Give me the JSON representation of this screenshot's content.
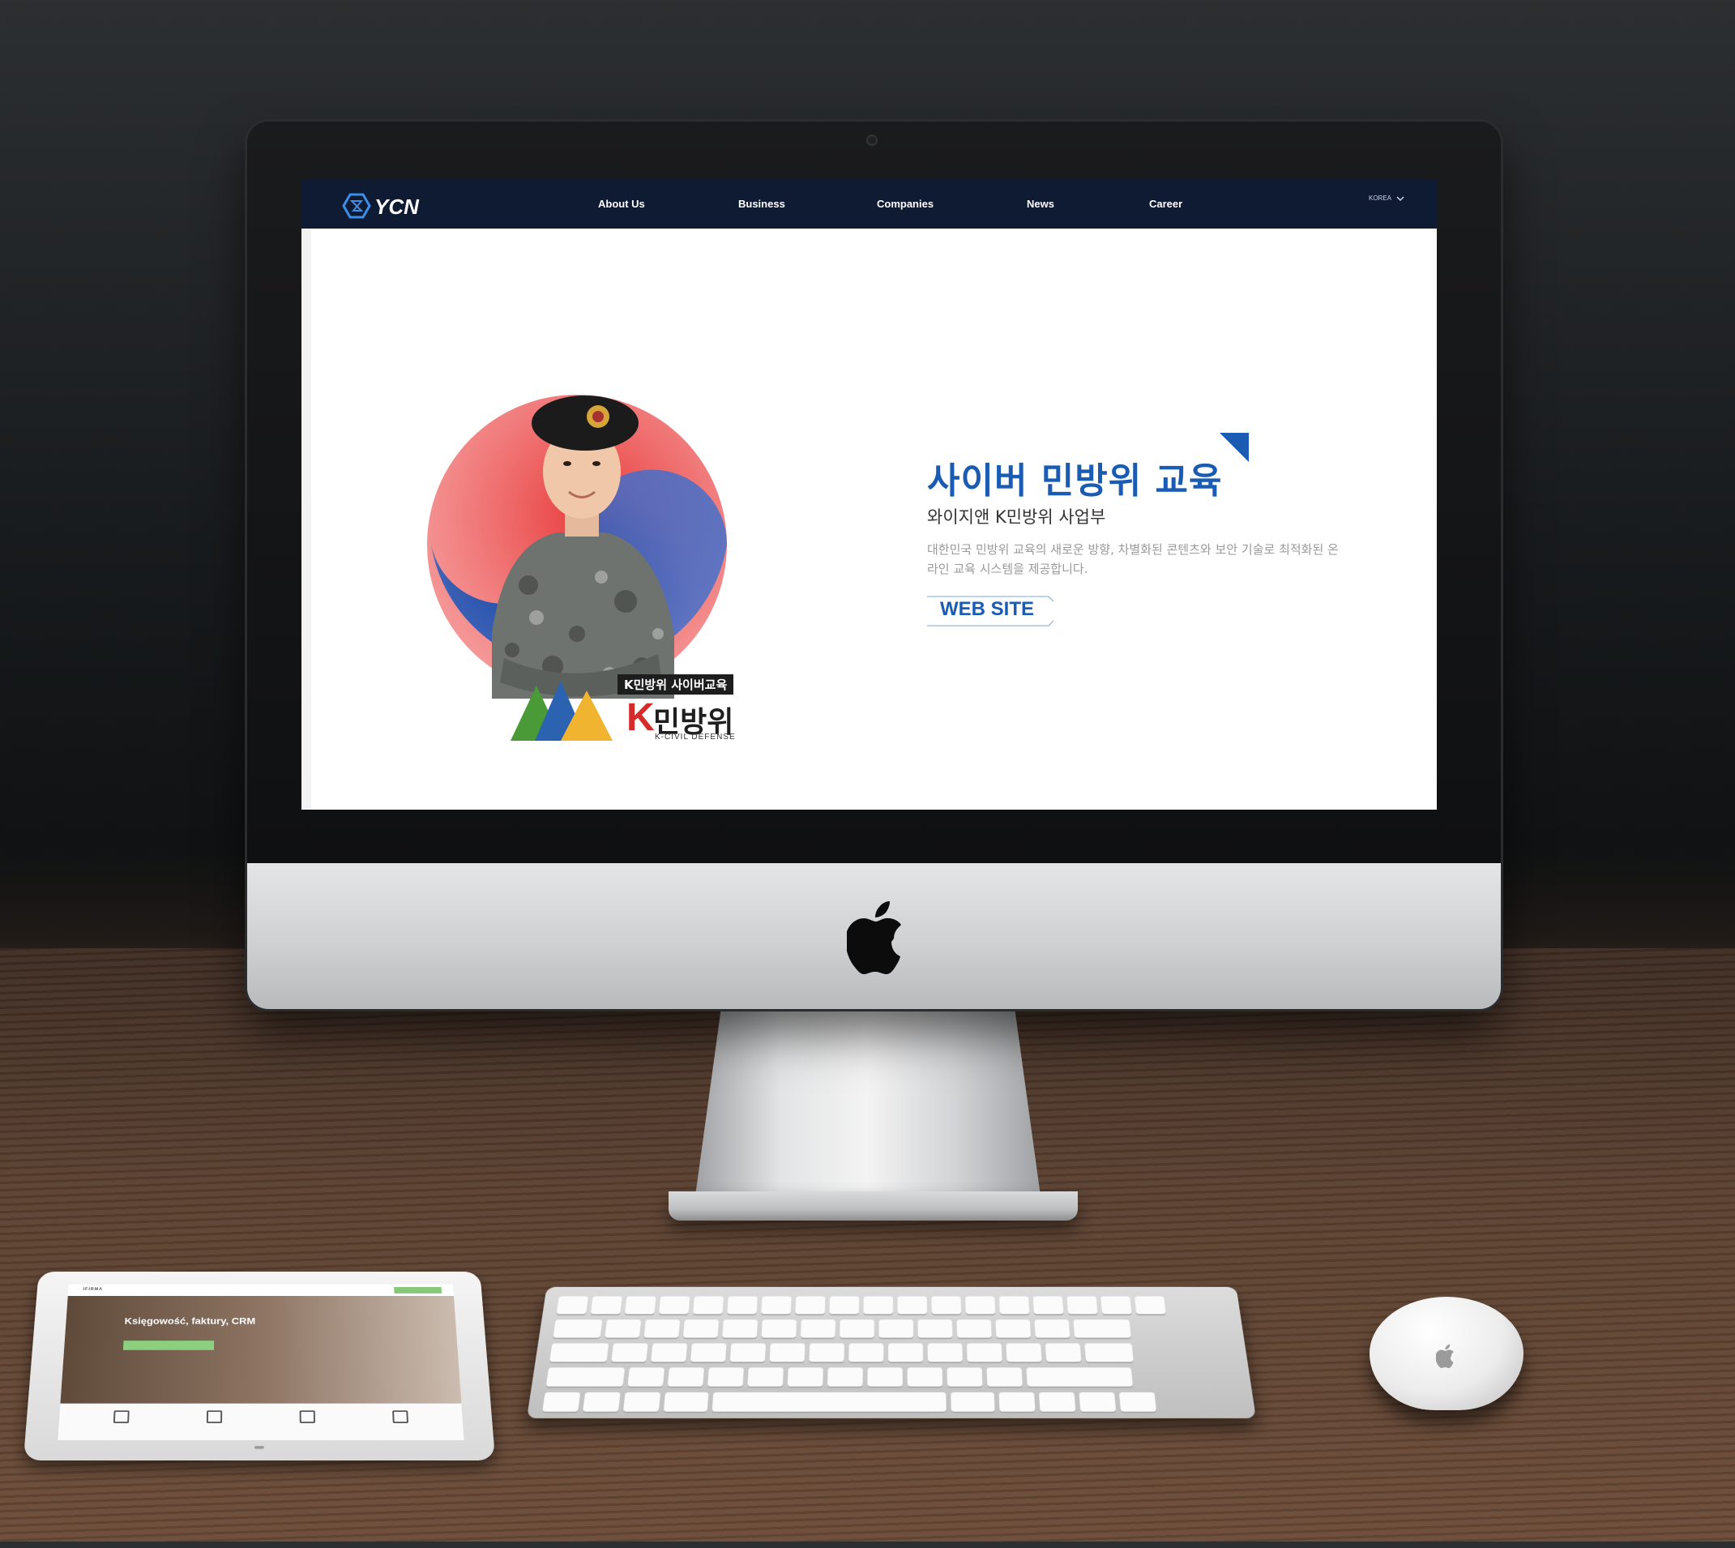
{
  "site": {
    "nav": {
      "logo_text": "YCN",
      "items": [
        {
          "label": "About Us"
        },
        {
          "label": "Business"
        },
        {
          "label": "Companies"
        },
        {
          "label": "News"
        },
        {
          "label": "Career"
        }
      ],
      "language": "KOREA"
    },
    "hero": {
      "headline": "사이버 민방위 교육",
      "subhead": "와이지앤 K민방위 사업부",
      "description": "대한민국 민방위 교육의 새로운 방향, 차별화된 콘텐츠와 보안 기술로 최적화된 온라인 교육 시스템을 제공합니다.",
      "button_label": "WEB SITE",
      "badge_label": "K민방위 사이버교육",
      "brand_k": "K",
      "brand_word": "민방위",
      "brand_eng": "K-CIVIL DEFENSE"
    }
  },
  "ipad_site": {
    "brand": "IFIRMA",
    "title": "Księgowość, faktury, CRM"
  },
  "colors": {
    "nav_bg": "#0f1a33",
    "accent_blue": "#1a5bb3",
    "accent_red": "#d62b2b"
  },
  "icons": [
    "apple-logo-icon",
    "chevron-down-icon",
    "corner-triangle-icon",
    "arrow-right-icon"
  ]
}
